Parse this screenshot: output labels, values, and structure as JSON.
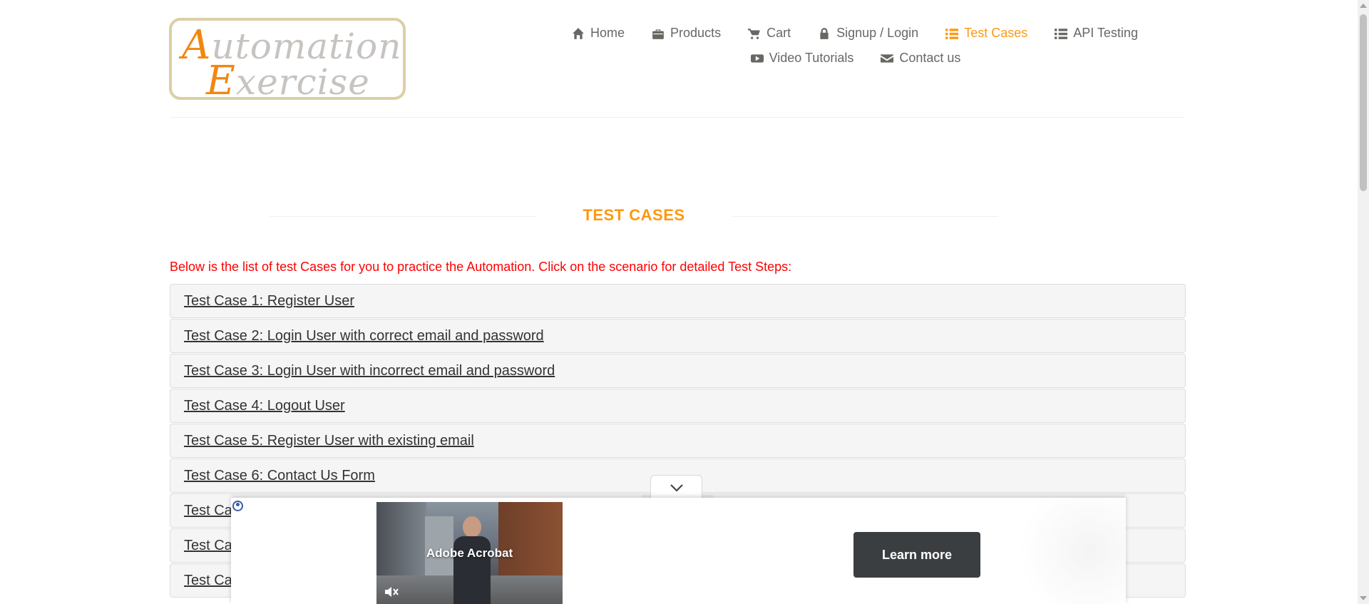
{
  "logo": {
    "cap1": "A",
    "rest1": "utomation",
    "cap2": "E",
    "rest2": "xercise"
  },
  "nav": {
    "row1": [
      {
        "label": "Home",
        "icon": "home-icon"
      },
      {
        "label": "Products",
        "icon": "briefcase-icon"
      },
      {
        "label": "Cart",
        "icon": "cart-icon"
      },
      {
        "label": "Signup / Login",
        "icon": "lock-icon"
      },
      {
        "label": "Test Cases",
        "icon": "list-icon",
        "active": true
      },
      {
        "label": "API Testing",
        "icon": "list-icon"
      }
    ],
    "row2": [
      {
        "label": "Video Tutorials",
        "icon": "youtube-play-icon"
      },
      {
        "label": "Contact us",
        "icon": "envelope-icon"
      }
    ],
    "active_color": "#fe980f"
  },
  "page": {
    "title": "TEST CASES",
    "intro": "Below is the list of test Cases for you to practice the Automation. Click on the scenario for detailed Test Steps:"
  },
  "cases": [
    "Test Case 1: Register User",
    "Test Case 2: Login User with correct email and password",
    "Test Case 3: Login User with incorrect email and password",
    "Test Case 4: Logout User",
    "Test Case 5: Register User with existing email",
    "Test Case 6: Contact Us Form",
    "Test Ca",
    "Test Ca",
    "Test Ca"
  ],
  "ad": {
    "brand": "Adobe Acrobat",
    "cta": "Learn more"
  }
}
